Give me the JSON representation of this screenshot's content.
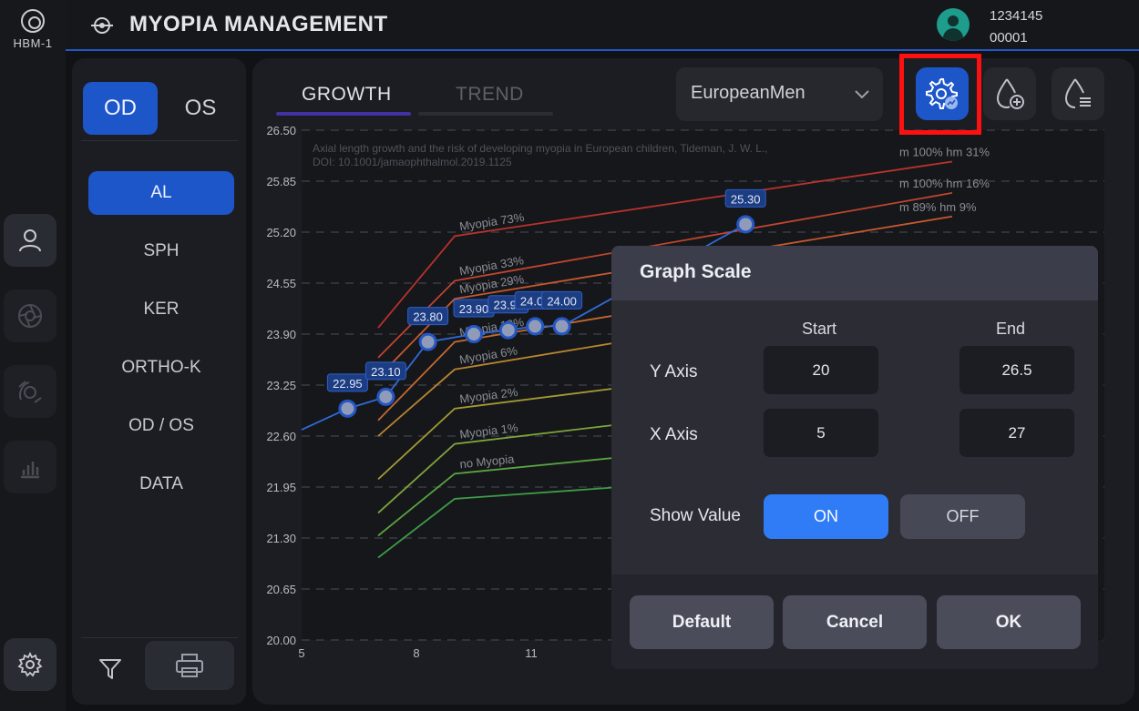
{
  "rail": {
    "logo_text": "HBM-1",
    "items": [
      {
        "icon": "user-icon"
      },
      {
        "icon": "aperture-icon"
      },
      {
        "icon": "eye-scan-icon"
      },
      {
        "icon": "bar-chart-icon"
      }
    ],
    "settings_icon": "gear-icon"
  },
  "header": {
    "title": "MYOPIA MANAGEMENT",
    "patient_id_1": "1234145",
    "patient_id_2": "00001"
  },
  "eye_tabs": [
    "OD",
    "OS"
  ],
  "nav_items": [
    "AL",
    "SPH",
    "KER",
    "ORTHO-K",
    "OD / OS",
    "DATA"
  ],
  "tabs": {
    "growth": "GROWTH",
    "trend": "TREND"
  },
  "dropdown": {
    "value": "EuropeanMen"
  },
  "colors": {
    "accent": "#1d56c9",
    "toggle_on": "#2f7cf6",
    "highlight": "#ff1010"
  },
  "chart_data": {
    "type": "line",
    "source_line_1": "Axial length growth and the risk of developing myopia in European children, Tideman, J. W. L.,",
    "source_line_2": "DOI: 10.1001/jamaophthalmol.2019.1125",
    "y_ticks": [
      "26.50",
      "25.85",
      "25.20",
      "24.55",
      "23.90",
      "23.25",
      "22.60",
      "21.95",
      "21.30",
      "20.65",
      "20.00"
    ],
    "x_ticks": [
      "5",
      "8",
      "11"
    ],
    "ylim": [
      20.0,
      26.5
    ],
    "xlim": [
      5,
      27
    ],
    "reference_curves": [
      {
        "label": "Myopia 73%",
        "right_label": "m 100% hm 31%",
        "color": "#b8322c",
        "points": [
          [
            7,
            23.98
          ],
          [
            9,
            25.15
          ],
          [
            22,
            26.1
          ]
        ]
      },
      {
        "label": "Myopia 33%",
        "right_label": "m 100% hm 16%",
        "color": "#c0452e",
        "points": [
          [
            7,
            23.6
          ],
          [
            9,
            24.58
          ],
          [
            22,
            25.7
          ]
        ]
      },
      {
        "label": "Myopia 29%",
        "right_label": "m 89% hm 9%",
        "color": "#c5582f",
        "points": [
          [
            7,
            23.35
          ],
          [
            9,
            24.35
          ],
          [
            22,
            25.4
          ]
        ]
      },
      {
        "label": "Myopia 12%",
        "right_label": "",
        "color": "#c26a30",
        "points": [
          [
            7,
            22.8
          ],
          [
            9,
            23.8
          ],
          [
            22,
            24.85
          ]
        ]
      },
      {
        "label": "Myopia 6%",
        "right_label": "",
        "color": "#b88530",
        "points": [
          [
            7,
            22.6
          ],
          [
            9,
            23.45
          ],
          [
            22,
            24.5
          ]
        ]
      },
      {
        "label": "Myopia 2%",
        "right_label": "",
        "color": "#a39a32",
        "points": [
          [
            7,
            22.05
          ],
          [
            9,
            22.95
          ],
          [
            22,
            23.75
          ]
        ]
      },
      {
        "label": "Myopia 1%",
        "right_label": "",
        "color": "#7fa53a",
        "points": [
          [
            7,
            21.62
          ],
          [
            9,
            22.5
          ],
          [
            22,
            23.25
          ]
        ]
      },
      {
        "label": "no Myopia",
        "right_label": "",
        "color": "#5aa540",
        "points": [
          [
            7,
            21.33
          ],
          [
            9,
            22.12
          ],
          [
            22,
            22.75
          ]
        ]
      },
      {
        "label": "",
        "right_label": "",
        "color": "#3e9c46",
        "points": [
          [
            7,
            21.05
          ],
          [
            9,
            21.8
          ],
          [
            22,
            22.25
          ]
        ]
      }
    ],
    "series": [
      {
        "name": "OD",
        "color": "#2f6bd8",
        "x": [
          6.2,
          7.2,
          8.3,
          9.5,
          10.4,
          11.1,
          11.8,
          16.6
        ],
        "y": [
          22.95,
          23.1,
          23.8,
          23.9,
          23.95,
          24.0,
          24.0,
          25.3
        ]
      }
    ]
  },
  "dialog": {
    "title": "Graph Scale",
    "start_label": "Start",
    "end_label": "End",
    "y_axis_label": "Y Axis",
    "x_axis_label": "X Axis",
    "y_start": "20",
    "y_end": "26.5",
    "x_start": "5",
    "x_end": "27",
    "show_value_label": "Show Value",
    "on_label": "ON",
    "off_label": "OFF",
    "default_label": "Default",
    "cancel_label": "Cancel",
    "ok_label": "OK"
  }
}
